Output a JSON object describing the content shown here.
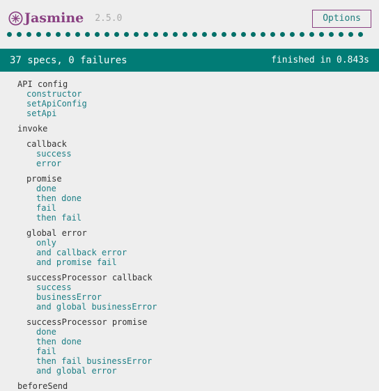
{
  "header": {
    "logo_icon": "jasmine-flower-icon",
    "brand": "Jasmine",
    "version": "2.5.0",
    "options_label": "Options",
    "brand_color": "#8a4182",
    "accent_color": "#1c7c7c"
  },
  "symbol_summary": {
    "count": 37,
    "passed_color": "#007069"
  },
  "results_bar": {
    "summary": "37 specs, 0 failures",
    "duration": "finished in 0.843s",
    "background_color": "#017c76",
    "text_color": "#ffffff"
  },
  "tree": {
    "suite_color": "#333333",
    "spec_color": "#1b7e85",
    "groups": [
      {
        "name": "API config",
        "level": 0,
        "specs": [
          {
            "label": "constructor",
            "level": 1
          },
          {
            "label": "setApiConfig",
            "level": 1
          },
          {
            "label": "setApi",
            "level": 1
          }
        ]
      },
      {
        "name": "invoke",
        "level": 0,
        "specs": []
      },
      {
        "name": "callback",
        "level": 1,
        "specs": [
          {
            "label": "success",
            "level": 2
          },
          {
            "label": "error",
            "level": 2
          }
        ]
      },
      {
        "name": "promise",
        "level": 1,
        "specs": [
          {
            "label": "done",
            "level": 2
          },
          {
            "label": "then done",
            "level": 2
          },
          {
            "label": "fail",
            "level": 2
          },
          {
            "label": "then fail",
            "level": 2
          }
        ]
      },
      {
        "name": "global error",
        "level": 1,
        "specs": [
          {
            "label": "only",
            "level": 2
          },
          {
            "label": "and callback error",
            "level": 2
          },
          {
            "label": "and promise fail",
            "level": 2
          }
        ]
      },
      {
        "name": "successProcessor callback",
        "level": 1,
        "specs": [
          {
            "label": "success",
            "level": 2
          },
          {
            "label": "businessError",
            "level": 2
          },
          {
            "label": "and global businessError",
            "level": 2
          }
        ]
      },
      {
        "name": "successProcessor promise",
        "level": 1,
        "specs": [
          {
            "label": "done",
            "level": 2
          },
          {
            "label": "then done",
            "level": 2
          },
          {
            "label": "fail",
            "level": 2
          },
          {
            "label": "then fail businessError",
            "level": 2
          },
          {
            "label": "and global error",
            "level": 2
          }
        ]
      },
      {
        "name": "beforeSend",
        "level": 0,
        "specs": []
      }
    ]
  }
}
